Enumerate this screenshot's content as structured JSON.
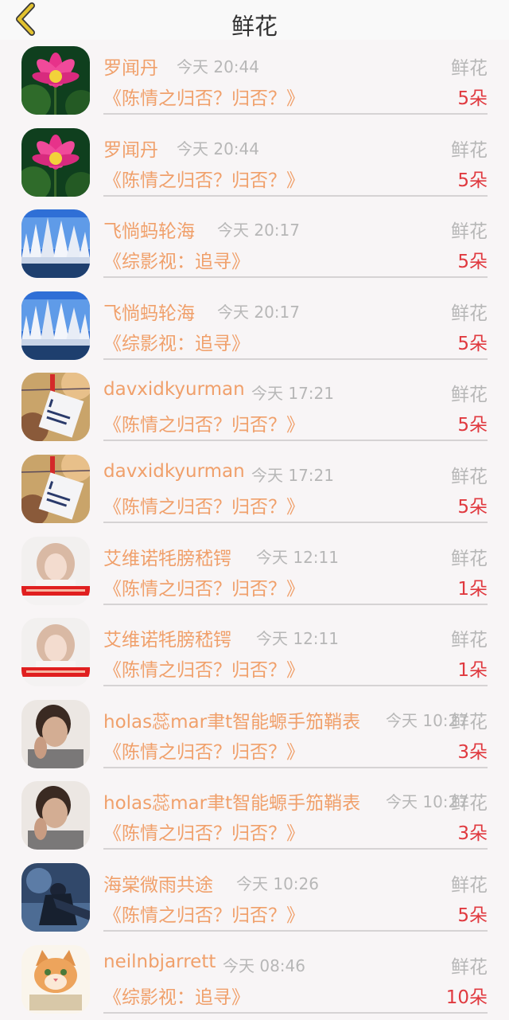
{
  "header": {
    "title": "鲜花"
  },
  "rows": [
    {
      "name": "罗闻丹",
      "time": "今天 20:44",
      "type": "鲜花",
      "book": "《陈情之归否？归否？》",
      "count": "5朵",
      "avatar": "lotus"
    },
    {
      "name": "罗闻丹",
      "time": "今天 20:44",
      "type": "鲜花",
      "book": "《陈情之归否？归否？》",
      "count": "5朵",
      "avatar": "lotus"
    },
    {
      "name": "飞惝蚂轮海",
      "time": "今天 20:17",
      "type": "鲜花",
      "book": "《综影视：追寻》",
      "count": "5朵",
      "avatar": "snow-trees"
    },
    {
      "name": "飞惝蚂轮海",
      "time": "今天 20:17",
      "type": "鲜花",
      "book": "《综影视：追寻》",
      "count": "5朵",
      "avatar": "snow-trees"
    },
    {
      "name": "davxidkyurman",
      "time": "今天 17:21",
      "type": "鲜花",
      "book": "《陈情之归否？归否？》",
      "count": "5朵",
      "avatar": "love-note"
    },
    {
      "name": "davxidkyurman",
      "time": "今天 17:21",
      "type": "鲜花",
      "book": "《陈情之归否？归否？》",
      "count": "5朵",
      "avatar": "love-note"
    },
    {
      "name": "艾维诺牦膀嵇锷",
      "time": "今天 12:11",
      "type": "鲜花",
      "book": "《陈情之归否？归否？》",
      "count": "1朵",
      "avatar": "girl"
    },
    {
      "name": "艾维诺牦膀嵇锷",
      "time": "今天 12:11",
      "type": "鲜花",
      "book": "《陈情之归否？归否？》",
      "count": "1朵",
      "avatar": "girl"
    },
    {
      "name": "holas蕊mar聿t智能螈手笳鞘表",
      "time": "今天 10:27",
      "type": "鲜花",
      "book": "《陈情之归否？归否？》",
      "count": "3朵",
      "avatar": "man"
    },
    {
      "name": "holas蕊mar聿t智能螈手笳鞘表",
      "time": "今天 10:27",
      "type": "鲜花",
      "book": "《陈情之归否？归否？》",
      "count": "3朵",
      "avatar": "man"
    },
    {
      "name": "海棠微雨共途",
      "time": "今天 10:26",
      "type": "鲜花",
      "book": "《陈情之归否？归否？》",
      "count": "5朵",
      "avatar": "ink-figure"
    },
    {
      "name": "neilnbjarrett",
      "time": "今天 08:46",
      "type": "鲜花",
      "book": "《综影视：追寻》",
      "count": "10朵",
      "avatar": "kitten"
    }
  ],
  "colors": {
    "accent": "#f0a06b",
    "count": "#e0393f",
    "muted": "#b7b7b7",
    "back": "#e2c230"
  }
}
